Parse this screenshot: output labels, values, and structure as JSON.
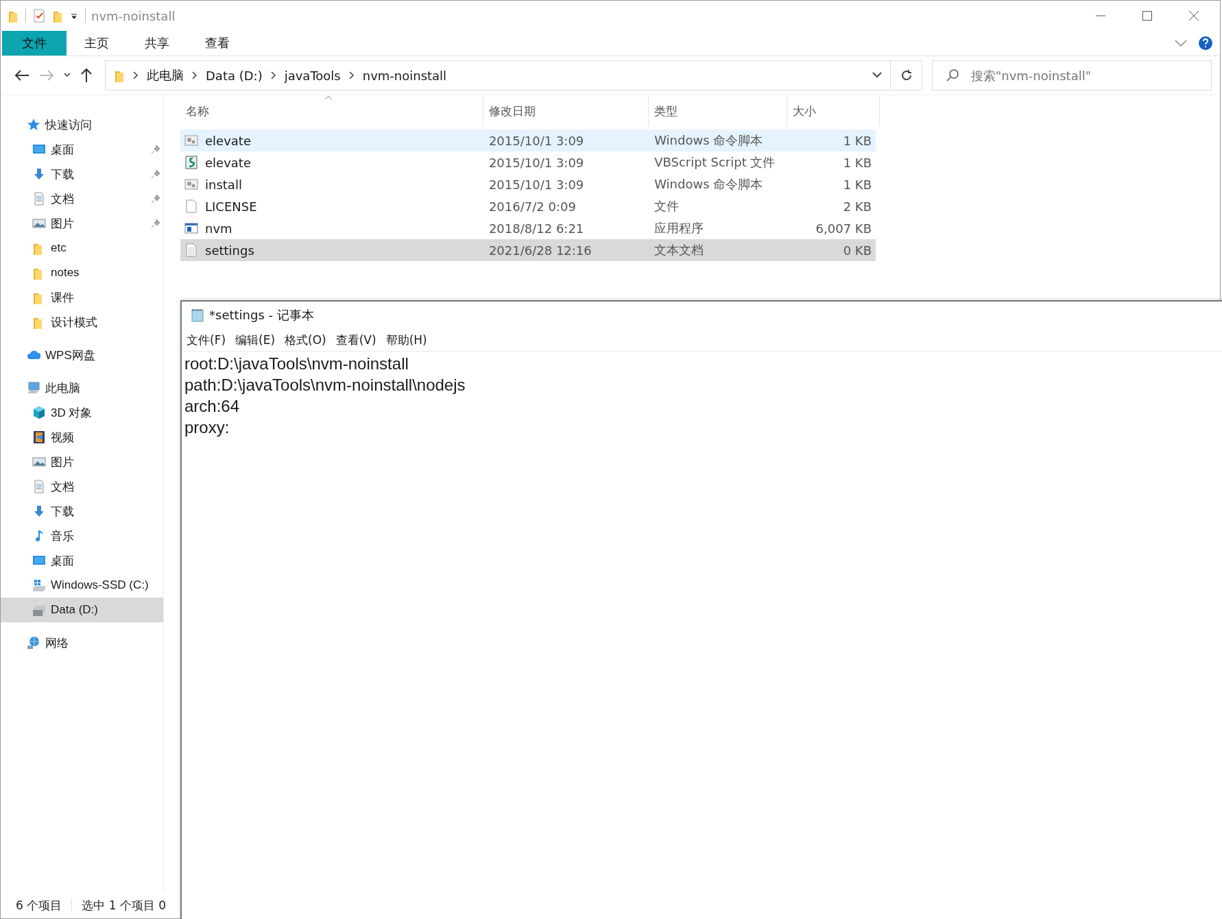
{
  "window": {
    "title": "nvm-noinstall"
  },
  "ribbon_tabs": [
    {
      "label": "文件",
      "selected": true
    },
    {
      "label": "主页",
      "selected": false
    },
    {
      "label": "共享",
      "selected": false
    },
    {
      "label": "查看",
      "selected": false
    }
  ],
  "address": {
    "breadcrumbs": [
      "此电脑",
      "Data (D:)",
      "javaTools",
      "nvm-noinstall"
    ]
  },
  "search": {
    "placeholder": "搜索\"nvm-noinstall\""
  },
  "sidebar": {
    "items": [
      {
        "label": "快速访问",
        "kind": "star",
        "selected": false,
        "children": [
          {
            "label": "桌面",
            "kind": "desktop",
            "pinned": true,
            "selected": false
          },
          {
            "label": "下载",
            "kind": "download",
            "pinned": true,
            "selected": false
          },
          {
            "label": "文档",
            "kind": "document",
            "pinned": true,
            "selected": false
          },
          {
            "label": "图片",
            "kind": "picture",
            "pinned": true,
            "selected": false
          },
          {
            "label": "etc",
            "kind": "folder",
            "pinned": false,
            "selected": false
          },
          {
            "label": "notes",
            "kind": "folder",
            "pinned": false,
            "selected": false
          },
          {
            "label": "课件",
            "kind": "folder",
            "pinned": false,
            "selected": false
          },
          {
            "label": "设计模式",
            "kind": "folder",
            "pinned": false,
            "selected": false
          }
        ]
      },
      {
        "label": "WPS网盘",
        "kind": "cloud",
        "selected": false
      },
      {
        "label": "此电脑",
        "kind": "computer",
        "selected": false,
        "children": [
          {
            "label": "3D 对象",
            "kind": "cube",
            "pinned": false,
            "selected": false
          },
          {
            "label": "视频",
            "kind": "video",
            "pinned": false,
            "selected": false
          },
          {
            "label": "图片",
            "kind": "picture",
            "pinned": false,
            "selected": false
          },
          {
            "label": "文档",
            "kind": "document",
            "pinned": false,
            "selected": false
          },
          {
            "label": "下载",
            "kind": "download",
            "pinned": false,
            "selected": false
          },
          {
            "label": "音乐",
            "kind": "music",
            "pinned": false,
            "selected": false
          },
          {
            "label": "桌面",
            "kind": "desktop",
            "pinned": false,
            "selected": false
          },
          {
            "label": "Windows-SSD (C:)",
            "kind": "windrive",
            "pinned": false,
            "selected": false
          },
          {
            "label": "Data (D:)",
            "kind": "drive",
            "pinned": false,
            "selected": true
          }
        ]
      },
      {
        "label": "网络",
        "kind": "network",
        "selected": false
      }
    ]
  },
  "file_list": {
    "columns": [
      "名称",
      "修改日期",
      "类型",
      "大小"
    ],
    "rows": [
      {
        "name": "elevate",
        "date": "2015/10/1 3:09",
        "type": "Windows 命令脚本",
        "size": "1 KB",
        "kind": "cmd",
        "hovered": true,
        "selected": false
      },
      {
        "name": "elevate",
        "date": "2015/10/1 3:09",
        "type": "VBScript Script 文件",
        "size": "1 KB",
        "kind": "vbs",
        "hovered": false,
        "selected": false
      },
      {
        "name": "install",
        "date": "2015/10/1 3:09",
        "type": "Windows 命令脚本",
        "size": "1 KB",
        "kind": "cmd",
        "hovered": false,
        "selected": false
      },
      {
        "name": "LICENSE",
        "date": "2016/7/2 0:09",
        "type": "文件",
        "size": "2 KB",
        "kind": "blank",
        "hovered": false,
        "selected": false
      },
      {
        "name": "nvm",
        "date": "2018/8/12 6:21",
        "type": "应用程序",
        "size": "6,007 KB",
        "kind": "exe",
        "hovered": false,
        "selected": false
      },
      {
        "name": "settings",
        "date": "2021/6/28 12:16",
        "type": "文本文档",
        "size": "0 KB",
        "kind": "text",
        "hovered": false,
        "selected": true
      }
    ]
  },
  "status_bar": {
    "items": [
      "6 个项目",
      "选中 1 个项目  0"
    ]
  },
  "notepad": {
    "title": "*settings - 记事本",
    "menu": [
      "文件(F)",
      "编辑(E)",
      "格式(O)",
      "查看(V)",
      "帮助(H)"
    ],
    "lines": [
      "root:D:\\javaTools\\nvm-noinstall",
      "path:D:\\javaTools\\nvm-noinstall\\nodejs",
      "arch:64",
      "proxy:"
    ]
  }
}
